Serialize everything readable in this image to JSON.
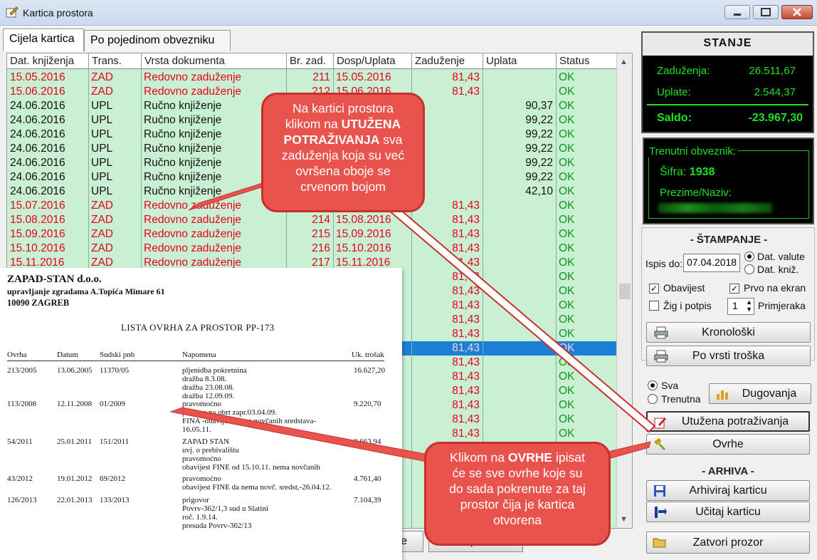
{
  "window": {
    "title": "Kartica prostora"
  },
  "tabs": [
    {
      "label": "Cijela kartica"
    },
    {
      "label": "Po pojedinom obvezniku"
    }
  ],
  "grid": {
    "columns": [
      "Dat. knjiženja",
      "Trans.",
      "Vrsta dokumenta",
      "Br. zad.",
      "Dosp/Uplata",
      "Zaduženje",
      "Uplata",
      "Status"
    ],
    "rows": [
      {
        "date": "15.05.2016",
        "trans": "ZAD",
        "doc": "Redovno zaduženje",
        "br": "211",
        "dosp": "15.05.2016",
        "zad": "81,43",
        "upl": "",
        "status": "OK",
        "color": "red"
      },
      {
        "date": "15.06.2016",
        "trans": "ZAD",
        "doc": "Redovno zaduženje",
        "br": "212",
        "dosp": "15.06.2016",
        "zad": "81,43",
        "upl": "",
        "status": "OK",
        "color": "red"
      },
      {
        "date": "24.06.2016",
        "trans": "UPL",
        "doc": "Ručno knjiženje",
        "br": "",
        "dosp": "",
        "zad": "",
        "upl": "90,37",
        "status": "OK",
        "color": "black"
      },
      {
        "date": "24.06.2016",
        "trans": "UPL",
        "doc": "Ručno knjiženje",
        "br": "",
        "dosp": "",
        "zad": "",
        "upl": "99,22",
        "status": "OK",
        "color": "black"
      },
      {
        "date": "24.06.2016",
        "trans": "UPL",
        "doc": "Ručno knjiženje",
        "br": "",
        "dosp": "",
        "zad": "",
        "upl": "99,22",
        "status": "OK",
        "color": "black"
      },
      {
        "date": "24.06.2016",
        "trans": "UPL",
        "doc": "Ručno knjiženje",
        "br": "",
        "dosp": "",
        "zad": "",
        "upl": "99,22",
        "status": "OK",
        "color": "black"
      },
      {
        "date": "24.06.2016",
        "trans": "UPL",
        "doc": "Ručno knjiženje",
        "br": "",
        "dosp": "",
        "zad": "",
        "upl": "99,22",
        "status": "OK",
        "color": "black"
      },
      {
        "date": "24.06.2016",
        "trans": "UPL",
        "doc": "Ručno knjiženje",
        "br": "",
        "dosp": "",
        "zad": "",
        "upl": "99,22",
        "status": "OK",
        "color": "black"
      },
      {
        "date": "24.06.2016",
        "trans": "UPL",
        "doc": "Ručno knjiženje",
        "br": "",
        "dosp": "",
        "zad": "",
        "upl": "42,10",
        "status": "OK",
        "color": "black"
      },
      {
        "date": "15.07.2016",
        "trans": "ZAD",
        "doc": "Redovno zaduženje",
        "br": "213",
        "dosp": "15.07.2016",
        "zad": "81,43",
        "upl": "",
        "status": "OK",
        "color": "red"
      },
      {
        "date": "15.08.2016",
        "trans": "ZAD",
        "doc": "Redovno zaduženje",
        "br": "214",
        "dosp": "15.08.2016",
        "zad": "81,43",
        "upl": "",
        "status": "OK",
        "color": "red"
      },
      {
        "date": "15.09.2016",
        "trans": "ZAD",
        "doc": "Redovno zaduženje",
        "br": "215",
        "dosp": "15.09.2016",
        "zad": "81,43",
        "upl": "",
        "status": "OK",
        "color": "red"
      },
      {
        "date": "15.10.2016",
        "trans": "ZAD",
        "doc": "Redovno zaduženje",
        "br": "216",
        "dosp": "15.10.2016",
        "zad": "81,43",
        "upl": "",
        "status": "OK",
        "color": "red"
      },
      {
        "date": "15.11.2016",
        "trans": "ZAD",
        "doc": "Redovno zaduženje",
        "br": "217",
        "dosp": "15.11.2016",
        "zad": "81,43",
        "upl": "",
        "status": "OK",
        "color": "red"
      },
      {
        "date": "",
        "trans": "",
        "doc": "",
        "br": "",
        "dosp": "",
        "zad": "81,43",
        "upl": "",
        "status": "OK",
        "color": "red"
      },
      {
        "date": "",
        "trans": "",
        "doc": "",
        "br": "",
        "dosp": "",
        "zad": "81,43",
        "upl": "",
        "status": "OK",
        "color": "red"
      },
      {
        "date": "",
        "trans": "",
        "doc": "",
        "br": "",
        "dosp": "",
        "zad": "81,43",
        "upl": "",
        "status": "OK",
        "color": "red"
      },
      {
        "date": "",
        "trans": "",
        "doc": "",
        "br": "",
        "dosp": "",
        "zad": "81,43",
        "upl": "",
        "status": "OK",
        "color": "red"
      },
      {
        "date": "",
        "trans": "",
        "doc": "",
        "br": "",
        "dosp": "",
        "zad": "81,43",
        "upl": "",
        "status": "OK",
        "color": "red"
      },
      {
        "date": "",
        "trans": "",
        "doc": "",
        "br": "",
        "dosp": "",
        "zad": "81,43",
        "upl": "",
        "status": "OK",
        "color": "red",
        "selected": true
      },
      {
        "date": "",
        "trans": "",
        "doc": "",
        "br": "",
        "dosp": "",
        "zad": "81,43",
        "upl": "",
        "status": "OK",
        "color": "red"
      },
      {
        "date": "",
        "trans": "",
        "doc": "",
        "br": "",
        "dosp": "",
        "zad": "81,43",
        "upl": "",
        "status": "OK",
        "color": "red"
      },
      {
        "date": "",
        "trans": "",
        "doc": "",
        "br": "",
        "dosp": "",
        "zad": "81,43",
        "upl": "",
        "status": "OK",
        "color": "red"
      },
      {
        "date": "",
        "trans": "",
        "doc": "",
        "br": "",
        "dosp": "",
        "zad": "81,43",
        "upl": "",
        "status": "OK",
        "color": "red"
      },
      {
        "date": "",
        "trans": "",
        "doc": "",
        "br": "",
        "dosp": "",
        "zad": "81,43",
        "upl": "",
        "status": "OK",
        "color": "red"
      },
      {
        "date": "",
        "trans": "",
        "doc": "",
        "br": "",
        "dosp": "",
        "zad": "81,43",
        "upl": "",
        "status": "OK",
        "color": "red"
      }
    ]
  },
  "stanje": {
    "title": "STANJE",
    "zaduzenja_label": "Zaduženja:",
    "zaduzenja": "26.511,67",
    "uplate_label": "Uplate:",
    "uplate": "2.544,37",
    "saldo_label": "Saldo:",
    "saldo": "-23.967,30"
  },
  "obveznik": {
    "legend": "Trenutni obveznik:",
    "sifra_label": "Šifra:",
    "sifra": "1938",
    "prezime_label": "Prezime/Naziv:"
  },
  "stampanje": {
    "title": "- ŠTAMPANJE -",
    "ispis_label": "Ispis do:",
    "ispis_value": "07.04.2018",
    "radio_valute": "Dat. valute",
    "radio_knjiz": "Dat. kniž.",
    "chk_obavijest": "Obavijest",
    "chk_prvo": "Prvo na ekran",
    "chk_zig": "Žig i potpis",
    "primjeraka_value": "1",
    "primjeraka_label": "Primjeraka",
    "btn_kronoloski": "Kronološki",
    "btn_po_vrsti": "Po vrsti troška"
  },
  "actions": {
    "radio_sva": "Sva",
    "radio_trenutna": "Trenutna",
    "btn_dugovanja": "Dugovanja",
    "btn_utuzena": "Utužena potraživanja",
    "btn_ovrhe": "Ovrhe"
  },
  "arhiva": {
    "title": "- ARHIVA -",
    "btn_arhiviraj": "Arhiviraj karticu",
    "btn_ucitaj": "Učitaj karticu",
    "btn_zatvori": "Zatvori prozor"
  },
  "bottom_partial": {
    "label_1": "e",
    "label_2": "E-pošta"
  },
  "callout_top": {
    "line1": "Na kartici prostora",
    "line2a": "klikom na ",
    "line2b": "UTUŽENA",
    "line3a": "POTRAŽIVANJA",
    "line3b": " sva",
    "line4": "zaduženja koja su već",
    "line5": "ovršena oboje se",
    "line6": "crvenom bojom"
  },
  "callout_bottom": {
    "line1a": "Klikom na ",
    "line1b": "OVRHE",
    "line1c": " ipisat",
    "line2": "će se sve ovrhe koje su",
    "line3": "do sada pokrenute za taj",
    "line4": "prostor čija je kartica",
    "line5": "otvorena"
  },
  "document": {
    "company": "ZAPAD-STAN d.o.o.",
    "subtitle": "upravljanje zgradama A.Topića Mimare 61",
    "city": "10090 ZAGREB",
    "title": "LISTA OVRHA ZA PROSTOR PP-173",
    "columns": [
      "Ovrha",
      "Datum",
      "Sudski pnb",
      "Napomena",
      "Uk. trošak"
    ],
    "entries": [
      {
        "ovrha": "213/2005",
        "datum": "13.06.2005",
        "pnb": "11370/05",
        "notes": [
          "pljenidba pokretnina",
          "dražba 8.3.08.",
          "dražba 23.08.08.",
          "dražba 12.09.09."
        ],
        "trosak": "16.627,20"
      },
      {
        "ovrha": "113/2008",
        "datum": "12.11.2008",
        "pnb": "01/2009",
        "notes": [
          "pravomoćno",
          "poslano na obrt zapr.03.04.09.",
          "FINA -obavijest nema novčanih sredstava-",
          "16.05.11."
        ],
        "trosak": "9.220,70"
      },
      {
        "ovrha": "54/2011",
        "datum": "25.01.2011",
        "pnb": "151/2011",
        "notes": [
          "ZAPAD STAN",
          "uvj. o prebivalištu",
          "pravomoćno",
          "obavijest  FINE od 15.10.11. nema novčanih"
        ],
        "trosak": "8.663,94"
      },
      {
        "ovrha": "43/2012",
        "datum": "19.01.2012",
        "pnb": "69/2012",
        "notes": [
          "pravomoćno",
          "obavijest FINE da nema novč. sredst,-26.04.12."
        ],
        "trosak": "4.761,40"
      },
      {
        "ovrha": "126/2013",
        "datum": "22.01.2013",
        "pnb": "133/2013",
        "notes": [
          "prigovor",
          "Povrv-362/1,3 sud u Slatini",
          "roč. 1.9.14.",
          "presuda Povrv-362/13"
        ],
        "trosak": "7.104,39"
      }
    ]
  },
  "colors": {
    "grid_bg": "#c9f0d2",
    "red_text": "#e8001c",
    "green_ok": "#0a9a1d",
    "selected": "#1b7fd6",
    "led_green": "#20e020",
    "callout": "#e8534e"
  }
}
